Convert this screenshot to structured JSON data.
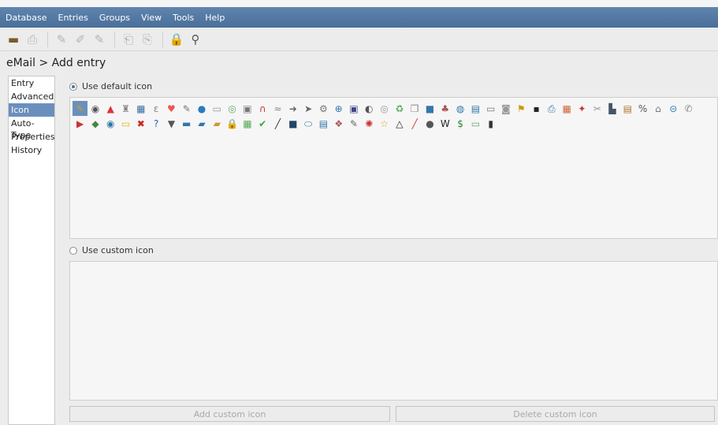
{
  "menu": [
    "Database",
    "Entries",
    "Groups",
    "View",
    "Tools",
    "Help"
  ],
  "toolbar": [
    {
      "icon": "open-database-icon",
      "glyph": "▬",
      "state": "on"
    },
    {
      "icon": "save-database-icon",
      "glyph": "⎙",
      "state": "off"
    },
    {
      "sep": true
    },
    {
      "icon": "add-entry-icon",
      "glyph": "✎",
      "state": "off"
    },
    {
      "icon": "edit-entry-icon",
      "glyph": "✐",
      "state": "off"
    },
    {
      "icon": "delete-entry-icon",
      "glyph": "✎",
      "state": "off"
    },
    {
      "sep": true
    },
    {
      "icon": "copy-username-icon",
      "glyph": "⎗",
      "state": "off"
    },
    {
      "icon": "copy-password-icon",
      "glyph": "⎘",
      "state": "off"
    },
    {
      "sep": true
    },
    {
      "icon": "lock-database-icon",
      "glyph": "🔒",
      "state": "key"
    },
    {
      "icon": "search-icon",
      "glyph": "⚲",
      "state": "mag"
    }
  ],
  "breadcrumb": "eMail > Add entry",
  "sidebar": {
    "items": [
      "Entry",
      "Advanced",
      "Icon",
      "Auto-Type",
      "Properties",
      "History"
    ],
    "selected": 2
  },
  "default_icon_label": "Use default icon",
  "custom_icon_label": "Use custom icon",
  "icons": [
    {
      "g": "✎",
      "c": "#c7a227"
    },
    {
      "g": "◉",
      "c": "#555"
    },
    {
      "g": "▲",
      "c": "#d33"
    },
    {
      "g": "♜",
      "c": "#888"
    },
    {
      "g": "▦",
      "c": "#3a6ea5"
    },
    {
      "g": "ɛ",
      "c": "#888"
    },
    {
      "g": "♥",
      "c": "#e55"
    },
    {
      "g": "✎",
      "c": "#777"
    },
    {
      "g": "●",
      "c": "#2a7ac0"
    },
    {
      "g": "▭",
      "c": "#999"
    },
    {
      "g": "◎",
      "c": "#6a6"
    },
    {
      "g": "▣",
      "c": "#777"
    },
    {
      "g": "∩",
      "c": "#c33"
    },
    {
      "g": "≈",
      "c": "#888"
    },
    {
      "g": "➜",
      "c": "#666"
    },
    {
      "g": "➤",
      "c": "#666"
    },
    {
      "g": "⚙",
      "c": "#777"
    },
    {
      "g": "⊕",
      "c": "#37a"
    },
    {
      "g": "▣",
      "c": "#448"
    },
    {
      "g": "◐",
      "c": "#555"
    },
    {
      "g": "◎",
      "c": "#999"
    },
    {
      "g": "♻",
      "c": "#5a5"
    },
    {
      "g": "❒",
      "c": "#888"
    },
    {
      "g": "■",
      "c": "#37a"
    },
    {
      "g": "♣",
      "c": "#a55"
    },
    {
      "g": "◍",
      "c": "#37a"
    },
    {
      "g": "▤",
      "c": "#37a"
    },
    {
      "g": "▭",
      "c": "#777"
    },
    {
      "g": "◙",
      "c": "#999"
    },
    {
      "g": "⚑",
      "c": "#c90"
    },
    {
      "g": "▪",
      "c": "#222"
    },
    {
      "g": "⎙",
      "c": "#37a"
    },
    {
      "g": "▦",
      "c": "#c63"
    },
    {
      "g": "✦",
      "c": "#c33"
    },
    {
      "g": "✂",
      "c": "#999"
    },
    {
      "g": "▙",
      "c": "#456"
    },
    {
      "g": "▤",
      "c": "#a73"
    },
    {
      "g": "%",
      "c": "#555"
    },
    {
      "g": "⌂",
      "c": "#777"
    },
    {
      "g": "⊝",
      "c": "#37a"
    },
    {
      "g": "✆",
      "c": "#888"
    },
    {
      "g": "▶",
      "c": "#c33"
    },
    {
      "g": "◆",
      "c": "#484"
    },
    {
      "g": "◉",
      "c": "#37a"
    },
    {
      "g": "▭",
      "c": "#db2"
    },
    {
      "g": "✖",
      "c": "#c22"
    },
    {
      "g": "?",
      "c": "#26a"
    },
    {
      "g": "▼",
      "c": "#555"
    },
    {
      "g": "▬",
      "c": "#37a"
    },
    {
      "g": "▰",
      "c": "#37a"
    },
    {
      "g": "▰",
      "c": "#c93"
    },
    {
      "g": "🔒",
      "c": "#d9a52a"
    },
    {
      "g": "▦",
      "c": "#5a5"
    },
    {
      "g": "✔",
      "c": "#3a3"
    },
    {
      "g": "╱",
      "c": "#333"
    },
    {
      "g": "■",
      "c": "#246"
    },
    {
      "g": "⬭",
      "c": "#37a"
    },
    {
      "g": "▤",
      "c": "#37a"
    },
    {
      "g": "❖",
      "c": "#a55"
    },
    {
      "g": "✎",
      "c": "#666"
    },
    {
      "g": "✺",
      "c": "#c33"
    },
    {
      "g": "☆",
      "c": "#d9a52a"
    },
    {
      "g": "△",
      "c": "#222"
    },
    {
      "g": "╱",
      "c": "#d33"
    },
    {
      "g": "●",
      "c": "#555"
    },
    {
      "g": "W",
      "c": "#222"
    },
    {
      "g": "$",
      "c": "#2a8a2a"
    },
    {
      "g": "▭",
      "c": "#6a6"
    },
    {
      "g": "▮",
      "c": "#333"
    }
  ],
  "buttons": {
    "add": "Add custom icon",
    "delete": "Delete custom icon"
  }
}
